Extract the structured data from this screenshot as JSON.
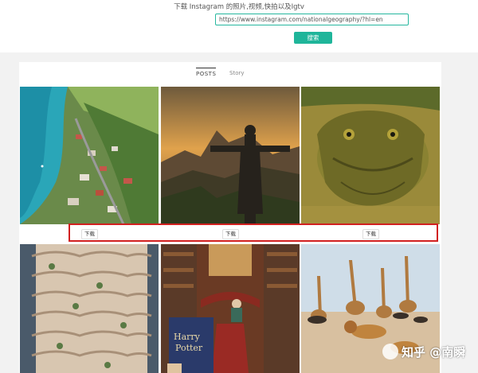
{
  "header": {
    "title": "下载 Instagram 的照片,视频,快拍以及Igtv",
    "url_value": "https://www.instagram.com/nationalgeography/?hl=en",
    "search_label": "搜索"
  },
  "tabs": [
    {
      "label": "POSTS",
      "active": true
    },
    {
      "label": "Story",
      "active": false
    }
  ],
  "posts": [
    {
      "subject": "coastal town aerial"
    },
    {
      "subject": "christ the redeemer statue"
    },
    {
      "subject": "crocodile in water"
    },
    {
      "subject": "curved balcony building"
    },
    {
      "subject": "bookstore staircase"
    },
    {
      "subject": "giraffes and lions on savanna"
    }
  ],
  "download_labels": [
    "下载",
    "下载",
    "下载"
  ],
  "book_text": {
    "line1": "Harry",
    "line2": "Potter"
  },
  "watermark": "知乎 @南瞬",
  "colors": {
    "accent": "#1fb59a",
    "highlight": "#d12020"
  }
}
